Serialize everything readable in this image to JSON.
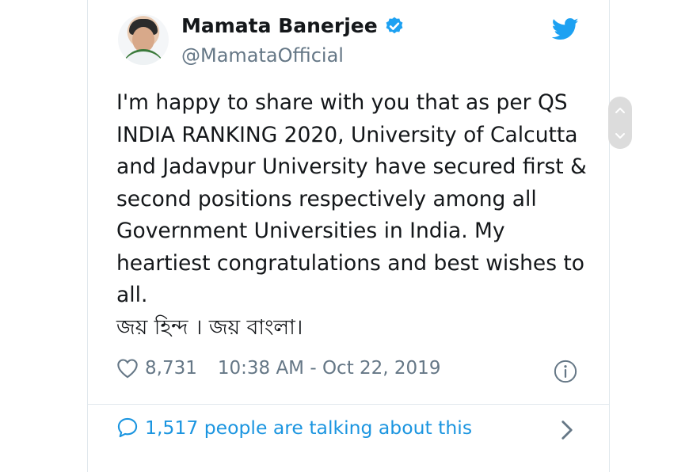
{
  "tweet": {
    "author_name": "Mamata Banerjee",
    "author_handle": "@MamataOfficial",
    "text": "I'm happy to share with you that as per QS\nINDIA RANKING 2020, University of Calcutta\nand Jadavpur University have secured first &\nsecond positions respectively among all\nGovernment Universities in India. My\nheartiest congratulations and best wishes to\nall.\nজয় হিন্দ । জয় বাংলা।",
    "likes": "8,731",
    "timestamp": "10:38 AM - Oct 22, 2019",
    "talking_about": "1,517 people are talking about this"
  },
  "icons": {
    "verified": "verified-badge-icon",
    "logo": "twitter-bird-icon",
    "like": "heart-icon",
    "info": "info-icon",
    "reply": "speech-bubble-icon",
    "chevron": "chevron-right-icon",
    "scroll_up": "chevron-up-icon",
    "scroll_down": "chevron-down-icon"
  },
  "colors": {
    "twitter_blue": "#1da1f2",
    "link_blue": "#1b95e0",
    "secondary_text": "#657786",
    "primary_text": "#14171a"
  }
}
